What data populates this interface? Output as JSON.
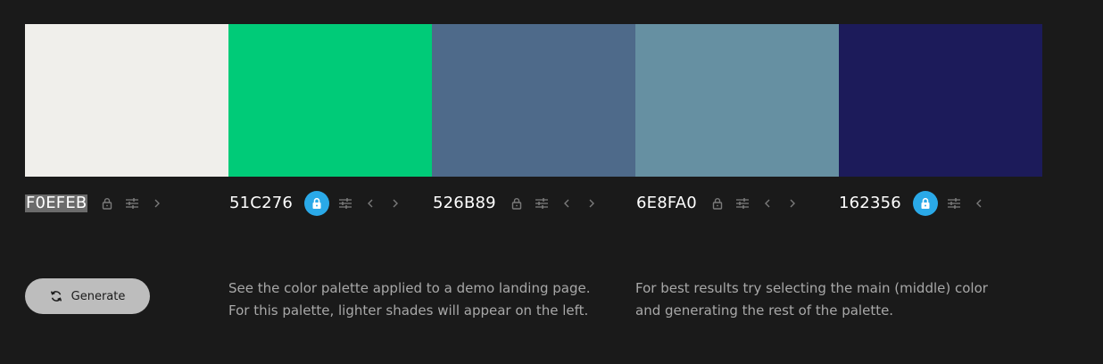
{
  "palette": {
    "colors": [
      {
        "hex": "F0EFEB",
        "swatch": "#F0EFEB",
        "locked": false,
        "selected": true
      },
      {
        "hex": "51C276",
        "swatch": "#00CB78",
        "locked": true,
        "selected": false
      },
      {
        "hex": "526B89",
        "swatch": "#4E6A8A",
        "locked": false,
        "selected": false
      },
      {
        "hex": "6E8FA0",
        "swatch": "#6690A2",
        "locked": false,
        "selected": false
      },
      {
        "hex": "162356",
        "swatch": "#1C1B5A",
        "locked": true,
        "selected": false
      }
    ]
  },
  "controls": {
    "icons": [
      "lock-icon",
      "sliders-icon",
      "chevron-left-icon",
      "chevron-right-icon"
    ]
  },
  "actions": {
    "generate_label": "Generate",
    "generate_icon": "refresh-icon"
  },
  "info": {
    "demo_line1": "See the color palette applied to a demo landing page.",
    "demo_line2": "For this palette, lighter shades will appear on the left.",
    "tip_line1": "For best results try selecting the main (middle) color",
    "tip_line2": "and generating the rest of the palette."
  },
  "theme": {
    "background": "#1a1a1a",
    "lock_active": "#2aa9e8",
    "muted_text": "#a8a8a8",
    "button_bg": "#bdbdbd"
  }
}
